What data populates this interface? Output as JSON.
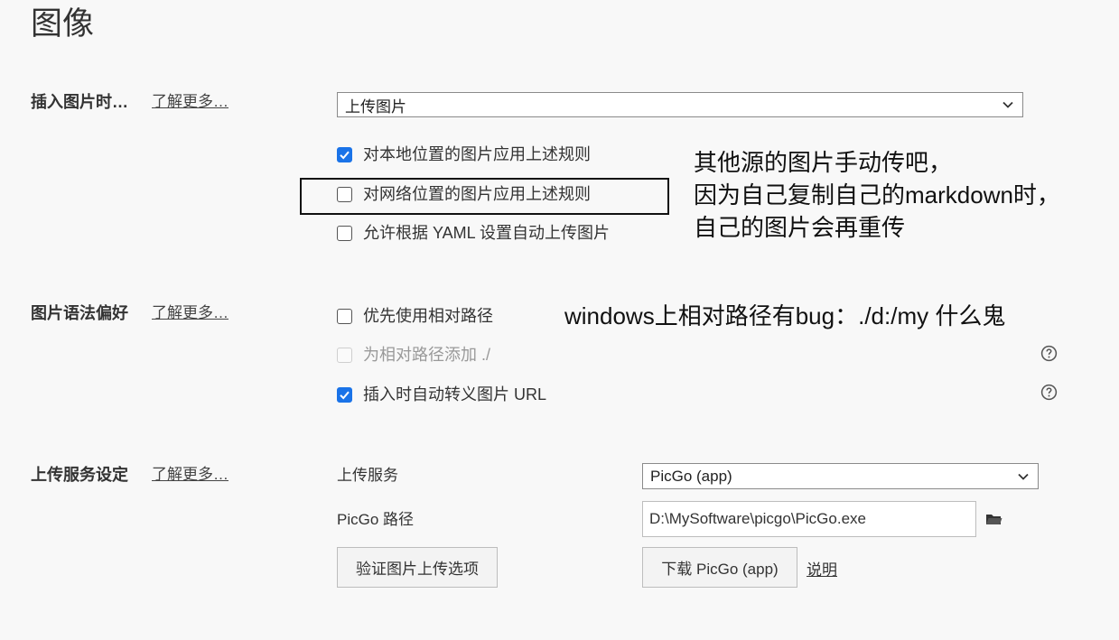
{
  "page": {
    "title": "图像"
  },
  "insert_section": {
    "label": "插入图片时…",
    "learn_more": "了解更多…",
    "action_value": "上传图片",
    "options": [
      {
        "label": "对本地位置的图片应用上述规则",
        "checked": true
      },
      {
        "label": "对网络位置的图片应用上述规则",
        "checked": false
      },
      {
        "label": "允许根据 YAML 设置自动上传图片",
        "checked": false
      }
    ],
    "annotation": [
      "其他源的图片手动传吧，",
      "因为自己复制自己的markdown时，",
      "自己的图片会再重传"
    ]
  },
  "syntax_section": {
    "label": "图片语法偏好",
    "learn_more": "了解更多…",
    "options": [
      {
        "label": "优先使用相对路径",
        "checked": false,
        "disabled": false
      },
      {
        "label": "为相对路径添加 ./",
        "checked": false,
        "disabled": true
      },
      {
        "label": "插入时自动转义图片 URL",
        "checked": true,
        "disabled": false
      }
    ],
    "annotation": "windows上相对路径有bug：./d:/my 什么鬼"
  },
  "upload_section": {
    "label": "上传服务设定",
    "learn_more": "了解更多…",
    "service_label": "上传服务",
    "service_value": "PicGo (app)",
    "path_label": "PicGo 路径",
    "path_value": "D:\\MySoftware\\picgo\\PicGo.exe",
    "verify_button": "验证图片上传选项",
    "download_button": "下载 PicGo (app)",
    "explain_link": "说明"
  },
  "colors": {
    "accent": "#1a73e8",
    "background": "#f8f8f8"
  },
  "icons": {
    "help": "help-circle-icon",
    "folder": "folder-icon",
    "dropdown": "chevron-down-icon"
  }
}
